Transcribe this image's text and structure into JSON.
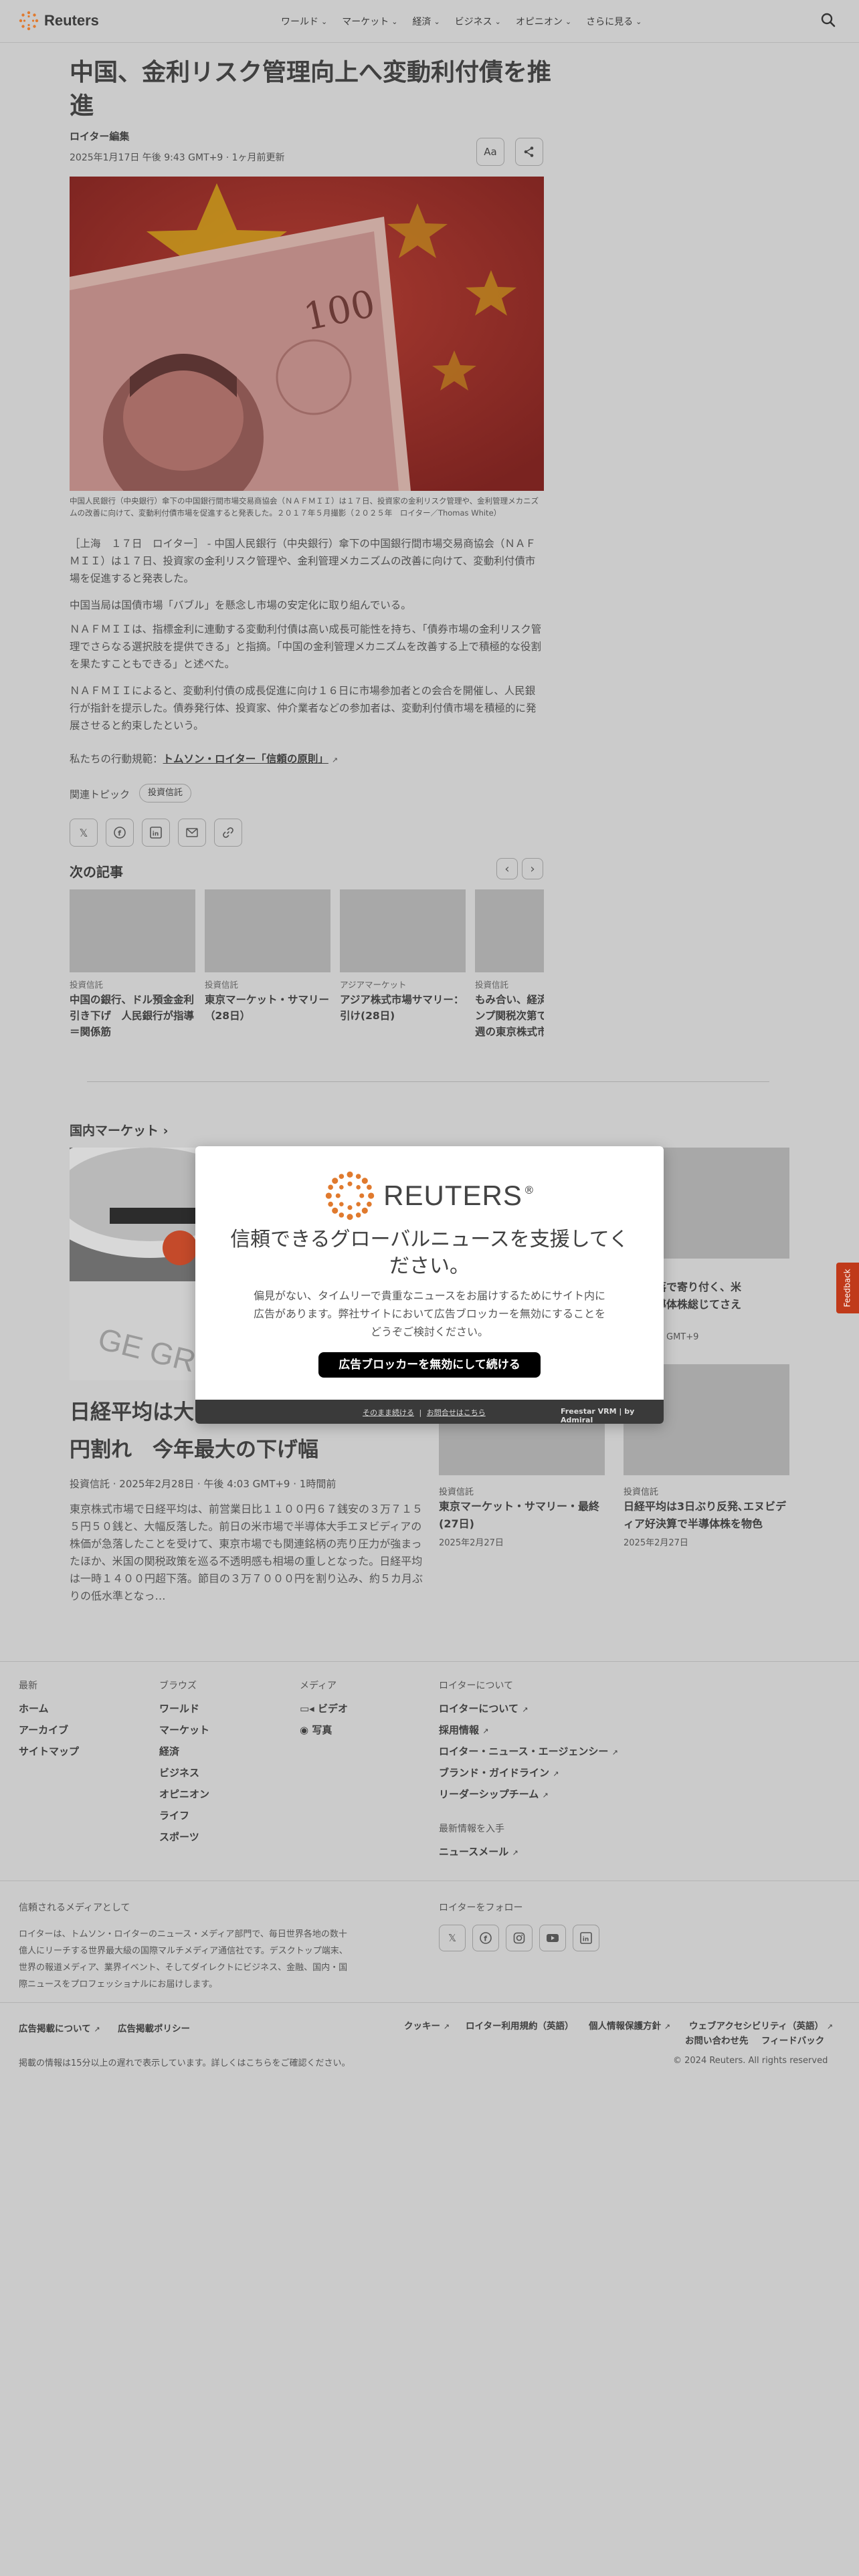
{
  "header": {
    "brand": "Reuters",
    "nav": [
      "ワールド",
      "マーケット",
      "経済",
      "ビジネス",
      "オピニオン",
      "さらに見る"
    ]
  },
  "article": {
    "headline": "中国、金利リスク管理向上へ変動利付債を推進",
    "byline": "ロイター編集",
    "date": "2025年1月17日 午後 9:43 GMT+9 · 1ヶ月前更新",
    "font_size_button": "Aa",
    "hero_banknote_value": "100",
    "caption": "中国人民銀行（中央銀行）傘下の中国銀行間市場交易商協会（ＮＡＦＭＩＩ）は１７日、投資家の金利リスク管理や、金利管理メカニズムの改善に向けて、変動利付債市場を促進すると発表した。２０１７年５月撮影（２０２５年　ロイター／Thomas White）",
    "paragraphs": [
      "［上海　１７日　ロイター］ - 中国人民銀行（中央銀行）傘下の中国銀行間市場交易商協会（ＮＡＦＭＩＩ）は１７日、投資家の金利リスク管理や、金利管理メカニズムの改善に向けて、変動利付債市場を促進すると発表した。",
      "中国当局は国債市場「バブル」を懸念し市場の安定化に取り組んでいる。",
      "ＮＡＦＭＩＩは、指標金利に連動する変動利付債は高い成長可能性を持ち、「債券市場の金利リスク管理でさらなる選択肢を提供できる」と指摘。「中国の金利管理メカニズムを改善する上で積極的な役割を果たすこともできる」と述べた。",
      "ＮＡＦＭＩＩによると、変動利付債の成長促進に向け１６日に市場参加者との会合を開催し、人民銀行が指針を提示した。債券発行体、投資家、仲介業者などの参加者は、変動利付債市場を積極的に発展させると約束したという。"
    ],
    "principles_prefix": "私たちの行動規範：",
    "principles_link": "トムソン・ロイター「信頼の原則」",
    "related_label": "関連トピック",
    "related_chip": "投資信託"
  },
  "next_articles": {
    "title": "次の記事",
    "items": [
      {
        "category": "投資信託",
        "title": "中国の銀行、ドル預金金利引き下げ　人民銀行が指導＝関係筋"
      },
      {
        "category": "投資信託",
        "title": "東京マーケット・サマリー（28日）"
      },
      {
        "category": "アジアマーケット",
        "title": "アジア株式市場サマリー：引け(28日)"
      },
      {
        "category": "投資信託",
        "title": "もみ合い、経済指標やトランプ関税次第で変動も＝来週の東京株式市場"
      }
    ]
  },
  "market": {
    "title": "国内マーケット",
    "lead": {
      "headline": "日経平均は大幅続落、３万７０００円割れ　今年最大の下げ幅",
      "headline_visible_start": "日経平均は大",
      "headline_visible_end": "円割れ　今年最大の下げ幅",
      "meta": "投資信託 · 2025年2月28日 · 午後 4:03 GMT+9 · 1時間前",
      "body": "東京株式市場で日経平均は、前営業日比１１００円６７銭安の３万７１５５円５０銭と、大幅反落した。前日の米市場で半導体大手エヌビディアの株価が急落したことを受けて、東京市場でも関連銘柄の売り圧力が強まったほか、米国の関税政策を巡る不透明感も相場の重しとなった。日経平均は一時１４００円超下落。節目の３万７０００円を割り込み、約５カ月ぶりの低水準となっ…"
    },
    "side_partial": {
      "title_line1": "は急反落で寄り付く、米",
      "title_line2": "気　半導体株総じてさえ",
      "date_tail": "GMT+9"
    },
    "side_items": [
      {
        "category": "投資信託",
        "title": "東京マーケット・サマリー・最終(27日)",
        "date": "2025年2月27日"
      },
      {
        "category": "投資信託",
        "title": "日経平均は3日ぶり反発､エヌビディア好決算で半導体株を物色",
        "date": "2025年2月27日"
      }
    ]
  },
  "modal": {
    "brand": "REUTERS",
    "brand_mark": "®",
    "title": "信頼できるグローバルニュースを支援してください。",
    "body": "偏見がない、タイムリーで貴重なニュースをお届けするためにサイト内に広告があります。弊社サイトにおいて広告ブロッカーを無効にすることをどうぞご検討ください。",
    "button": "広告ブロッカーを無効にして続ける",
    "footer_continue": "そのまま続ける",
    "footer_separator": "|",
    "footer_help": "お問合せはこちら",
    "footer_brand": "Freestar VRM",
    "footer_by": "by Admiral"
  },
  "feedback": "Feedback",
  "footer": {
    "col1": {
      "head": "最新",
      "links": [
        "ホーム",
        "アーカイブ",
        "サイトマップ"
      ]
    },
    "col2": {
      "head": "ブラウズ",
      "links": [
        "ワールド",
        "マーケット",
        "経済",
        "ビジネス",
        "オピニオン",
        "ライフ",
        "スポーツ"
      ]
    },
    "col3": {
      "head": "メディア",
      "links": [
        "ビデオ",
        "写真"
      ]
    },
    "col4": {
      "head": "ロイターについて",
      "links": [
        "ロイターについて",
        "採用情報",
        "ロイター・ニュース・エージェンシー",
        "ブランド・ガイドライン",
        "リーダーシップチーム"
      ]
    },
    "newsletter_head": "最新情報を入手",
    "newsletter_link": "ニュースメール",
    "trusted_head": "信頼されるメディアとして",
    "trusted_body": "ロイターは、トムソン・ロイターのニュース・メディア部門で、毎日世界各地の数十億人にリーチする世界最大級の国際マルチメディア通信社です。デスクトップ端末、世界の報道メディア、業界イベント、そしてダイレクトにビジネス、金融、国内・国際ニュースをプロフェッショナルにお届けします。",
    "follow_head": "ロイターをフォロー",
    "legal_left": [
      "広告掲載について",
      "広告掲載ポリシー"
    ],
    "legal_right": [
      "クッキー",
      "ロイター利用規約（英語）",
      "個人情報保護方針",
      "ウェブアクセシビリティ（英語）"
    ],
    "legal_right2": [
      "お問い合わせ先",
      "フィードバック"
    ],
    "delay_note": "掲載の情報は15分以上の遅れで表示しています。詳しくはこちらをご確認ください。",
    "copyright": "© 2024 Reuters. All rights reserved"
  }
}
